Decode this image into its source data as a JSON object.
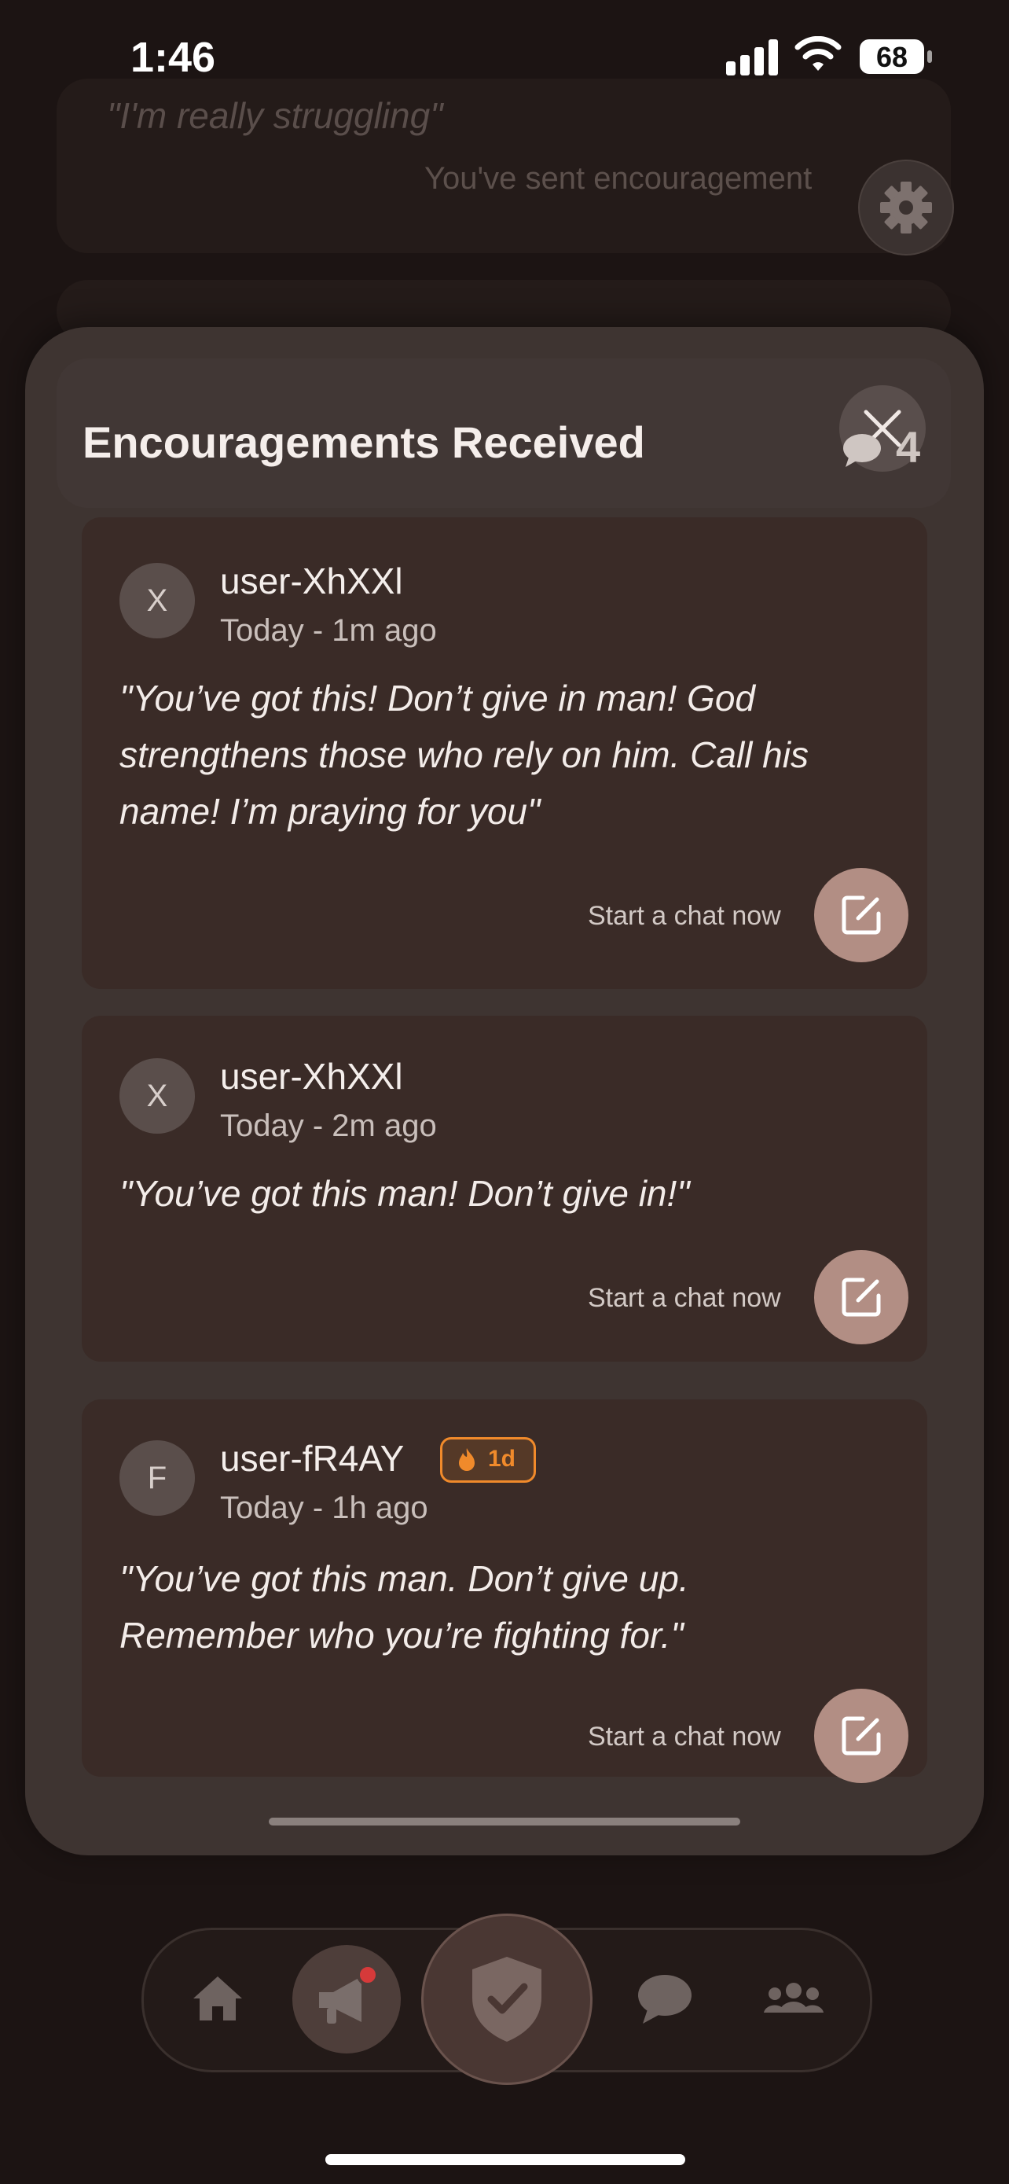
{
  "status_bar": {
    "time": "1:46",
    "battery": "68"
  },
  "background": {
    "quote": "\"I'm really struggling\"",
    "sent_text": "You've sent encouragement"
  },
  "sheet": {
    "title": "Encouragements Received",
    "count": "4",
    "items": [
      {
        "avatar_letter": "X",
        "username": "user-XhXXl",
        "time": "Today - 1m ago",
        "message_lines": [
          "\"You’ve got this! Don’t give in man! God",
          "strengthens those who rely on him. Call his",
          "name! I’m praying for you\""
        ],
        "chat_label": "Start a chat now"
      },
      {
        "avatar_letter": "X",
        "username": "user-XhXXl",
        "time": "Today - 2m ago",
        "message_lines": [
          "\"You’ve got this man! Don’t give in!\""
        ],
        "chat_label": "Start a chat now"
      },
      {
        "avatar_letter": "F",
        "username": "user-fR4AY",
        "badge": "1d",
        "time": "Today - 1h ago",
        "message_lines": [
          "\"You’ve got this man. Don’t give up.",
          "Remember who you’re fighting for.\""
        ],
        "chat_label": "Start a chat now"
      }
    ]
  },
  "tab_bar": {
    "items": [
      "home-icon",
      "megaphone-icon",
      "shield-check-icon",
      "chat-bubble-icon",
      "group-icon"
    ]
  },
  "colors": {
    "accent": "#b28e84",
    "streak": "#f08a2b",
    "sheet": "#3e3431"
  }
}
